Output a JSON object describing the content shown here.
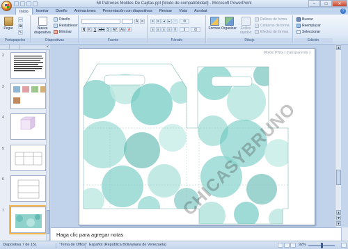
{
  "window": {
    "title": "58 Patrones Moldes De Cajitas.ppt [Modo de compatibilidad] - Microsoft PowerPoint",
    "controls": [
      "–",
      "□",
      "✕"
    ]
  },
  "tabs": [
    "Inicio",
    "Insertar",
    "Diseño",
    "Animaciones",
    "Presentación con diapositivas",
    "Revisar",
    "Vista",
    "Acrobat"
  ],
  "active_tab": "Inicio",
  "ribbon": {
    "clipboard": {
      "paste": "Pegar",
      "label": "Portapapeles"
    },
    "slides": {
      "new_slide": "Nueva diapositiva",
      "layout": "Diseño",
      "reset": "Restablecer",
      "delete": "Eliminar",
      "label": "Diapositivas"
    },
    "font": {
      "label": "Fuente",
      "buttons": [
        "N",
        "K",
        "S",
        "abc",
        "S",
        "AV",
        "Aa",
        "A"
      ]
    },
    "paragraph": {
      "label": "Párrafo"
    },
    "drawing": {
      "shapes": "Formas",
      "arrange": "Organizar",
      "quick_styles": "Estilos rápidos",
      "fill": "Relleno de forma",
      "outline": "Contorno de forma",
      "effects": "Efectos de formas",
      "label": "Dibujo"
    },
    "editing": {
      "find": "Buscar",
      "replace": "Reemplazar",
      "select": "Seleccionar",
      "label": "Edición"
    }
  },
  "slides_panel": {
    "numbers": [
      "2",
      "3",
      "4",
      "5",
      "6",
      "7"
    ],
    "selected": "7"
  },
  "slide": {
    "caption": "Molde PNG ( transparente )",
    "watermark": "CHICASYBRUNO"
  },
  "notes": {
    "placeholder": "Haga clic para agregar notas"
  },
  "statusbar": {
    "slide_info": "Diapositiva 7 de 151",
    "theme": "\"Tema de Office\"",
    "language": "Español (República Bolivariana de Venezuela)",
    "zoom": "92%"
  },
  "colors": {
    "ribbon_blue": "#dde8f6",
    "teal_pattern": "#62c4bd",
    "selection": "#f6b54a"
  }
}
